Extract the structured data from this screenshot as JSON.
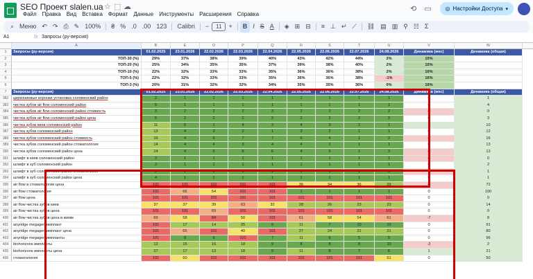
{
  "window": {
    "doc_title": "SEO Проект slalen.ua",
    "menu": [
      "Файл",
      "Правка",
      "Вид",
      "Вставка",
      "Формат",
      "Данные",
      "Инструменты",
      "Расширения",
      "Справка"
    ],
    "share_label": "Настройки Доступа"
  },
  "toolbar": {
    "menu_search": "Меню",
    "zoom": "100%",
    "font": "Calibri",
    "font_size": "11"
  },
  "formula_bar": {
    "name_box": "A1",
    "fx": "fx",
    "content": "Запросы (ру-версия)"
  },
  "columns": [
    "A",
    "B",
    "E",
    "O",
    "P",
    "Q",
    "R",
    "S",
    "T",
    "U",
    "V",
    "W"
  ],
  "rows": [
    {
      "n": "1",
      "cells": [
        "Запросы (ру-версия)",
        "01.02.2025",
        "23.01.2026",
        "22.02.2026",
        "22.03.2026",
        "22.04.2026",
        "22.05.2026",
        "22.06.2026",
        "22.07.2026",
        "24.08.2026",
        "Динамика (мес)",
        "Динамика (общая)"
      ],
      "style": "hdr"
    },
    {
      "n": "2",
      "cells": [
        "ТОП-30 (%)",
        "29%",
        "37%",
        "38%",
        "39%",
        "40%",
        "43%",
        "42%",
        "44%",
        "2%",
        "15%",
        ""
      ],
      "style": "stat"
    },
    {
      "n": "3",
      "cells": [
        "ТОП-20 (%)",
        "25%",
        "34%",
        "35%",
        "35%",
        "37%",
        "39%",
        "38%",
        "40%",
        "2%",
        "15%",
        ""
      ],
      "style": "stat"
    },
    {
      "n": "4",
      "cells": [
        "ТОП-10 (%)",
        "22%",
        "32%",
        "33%",
        "33%",
        "35%",
        "36%",
        "36%",
        "38%",
        "2%",
        "16%",
        ""
      ],
      "style": "stat"
    },
    {
      "n": "5",
      "cells": [
        "ТОП-5 (%)",
        "22%",
        "32%",
        "33%",
        "33%",
        "35%",
        "36%",
        "36%",
        "38%",
        "-1%",
        "16%",
        ""
      ],
      "style": "stat"
    },
    {
      "n": "6",
      "cells": [
        "ТОП-3 (%)",
        "20%",
        "31%",
        "32%",
        "32%",
        "34%",
        "35%",
        "35%",
        "36%",
        "0%",
        "16%",
        ""
      ],
      "style": "stat"
    },
    {
      "n": "7",
      "cells": [
        "Запросы (ру-версия)",
        "01.02.2025",
        "23.01.2026",
        "22.02.2026",
        "22.03.2026",
        "22.04.2026",
        "22.05.2026",
        "22.06.2026",
        "22.07.2026",
        "24.08.2026",
        "Динамика (мес)",
        "Динамика (общая)"
      ],
      "style": "hdr"
    },
    {
      "n": "382",
      "cells": [
        "циркониевые коронки установка соломенский район",
        "2",
        "1",
        "1",
        "1",
        "1",
        "1",
        "1",
        "1",
        "1",
        "0",
        "1"
      ]
    },
    {
      "n": "383",
      "cells": [
        "чистка зубов air flow соломенский район",
        "5",
        "1",
        "1",
        "1",
        "1",
        "1",
        "1",
        "1",
        "1",
        "0",
        "4"
      ]
    },
    {
      "n": "384",
      "cells": [
        "чистка зубов air flow соломенский район стоимость",
        "3",
        "2",
        "2",
        "2",
        "3",
        "2",
        "2",
        "2",
        "2",
        "-1",
        "0"
      ]
    },
    {
      "n": "385",
      "cells": [
        "чистка зубов air flow соломенский район цена",
        "5",
        "2",
        "2",
        "2",
        "2",
        "2",
        "2",
        "2",
        "2",
        "0",
        "3"
      ]
    },
    {
      "n": "386",
      "cells": [
        "чистка зубов киев соломенский район",
        "11",
        "5",
        "1",
        "4",
        "3",
        "4",
        "3",
        "2",
        "1",
        "1",
        "10"
      ]
    },
    {
      "n": "387",
      "cells": [
        "чистка зубов соломенский район",
        "13",
        "4",
        "3",
        "2",
        "1",
        "3",
        "2",
        "1",
        "1",
        "0",
        "12"
      ]
    },
    {
      "n": "388",
      "cells": [
        "чистка зубов соломенский район стоимость",
        "16",
        "4",
        "6",
        "7",
        "7",
        "6",
        "4",
        "1",
        "2",
        "-2",
        "16"
      ]
    },
    {
      "n": "389",
      "cells": [
        "чистка зубов соломенский район стоматология",
        "14",
        "4",
        "4",
        "3",
        "4",
        "4",
        "2",
        "1",
        "1",
        "0",
        "13"
      ]
    },
    {
      "n": "390",
      "cells": [
        "чистка зубов соломенский район цена",
        "14",
        "4",
        "5",
        "8",
        "6",
        "4",
        "6",
        "1",
        "3",
        "-2",
        "13"
      ]
    },
    {
      "n": "391",
      "cells": [
        "шлифт в киев соломенский район",
        "3",
        "1",
        "1",
        "1",
        "1",
        "1",
        "1",
        "1",
        "1",
        "-2",
        "0"
      ]
    },
    {
      "n": "392",
      "cells": [
        "шлифт в зуб соломенский район",
        "3",
        "1",
        "1",
        "1",
        "1",
        "1",
        "1",
        "1",
        "1",
        "0",
        "2"
      ]
    },
    {
      "n": "393",
      "cells": [
        "шлифт в зуб соломенский район стоматология",
        "3",
        "1",
        "1",
        "1",
        "1",
        "1",
        "1",
        "1",
        "3",
        "-2",
        "1"
      ]
    },
    {
      "n": "394",
      "cells": [
        "шлифт в зуб соломенский район цена",
        "4",
        "1",
        "1",
        "1",
        "1",
        "1",
        "1",
        "1",
        "1",
        "0",
        "1"
      ]
    },
    {
      "n": "395",
      "cells": [
        "air flow в стоматологии цена",
        "101",
        "101",
        "101",
        "101",
        "101",
        "36",
        "34",
        "36",
        "29",
        "-1",
        "72"
      ]
    },
    {
      "n": "396",
      "cells": [
        "air flow стоматология",
        "101",
        "66",
        "54",
        "101",
        "101",
        "1",
        "1",
        "1",
        "1",
        "0",
        "100"
      ]
    },
    {
      "n": "397",
      "cells": [
        "air flow цена",
        "101",
        "101",
        "101",
        "101",
        "101",
        "101",
        "101",
        "101",
        "101",
        "0",
        "0"
      ]
    },
    {
      "n": "398",
      "cells": [
        "air flow чистка зубов киев",
        "37",
        "37",
        "39",
        "63",
        "32",
        "28",
        "26",
        "23",
        "23",
        "0",
        "14"
      ]
    },
    {
      "n": "399",
      "cells": [
        "air flow чистка зубов цена",
        "101",
        "101",
        "69",
        "101",
        "101",
        "101",
        "101",
        "101",
        "101",
        "0",
        "0"
      ]
    },
    {
      "n": "400",
      "cells": [
        "air flow чистка зубов цена в киеве",
        "69",
        "58",
        "84",
        "50",
        "101",
        "61",
        "58",
        "54",
        "61",
        "-7",
        "8"
      ]
    },
    {
      "n": "401",
      "cells": [
        "anyridge megagen имплант",
        "101",
        "17",
        "14",
        "25",
        "9",
        "11",
        "7",
        "10",
        "10",
        "0",
        "91"
      ]
    },
    {
      "n": "402",
      "cells": [
        "anyridge megagen имплант цена",
        "101",
        "65",
        "101",
        "40",
        "101",
        "27",
        "24",
        "21",
        "21",
        "0",
        "80"
      ]
    },
    {
      "n": "403",
      "cells": [
        "anyridge megagen импланты",
        "101",
        "8",
        "6",
        "101",
        "7",
        "11",
        "6",
        "5",
        "5",
        "0",
        "96"
      ]
    },
    {
      "n": "404",
      "cells": [
        "biohorizons импланты",
        "12",
        "15",
        "15",
        "18",
        "9",
        "8",
        "8",
        "8",
        "10",
        "-2",
        "2"
      ]
    },
    {
      "n": "405",
      "cells": [
        "biohorizons импланты цена",
        "27",
        "17",
        "13",
        "18",
        "9",
        "11",
        "8",
        "7",
        "6",
        "1",
        "21"
      ]
    },
    {
      "n": "406",
      "cells": [
        "стоматология",
        "101",
        "60",
        "101",
        "101",
        "101",
        "101",
        "101",
        "101",
        "51",
        "0",
        "50"
      ]
    }
  ]
}
